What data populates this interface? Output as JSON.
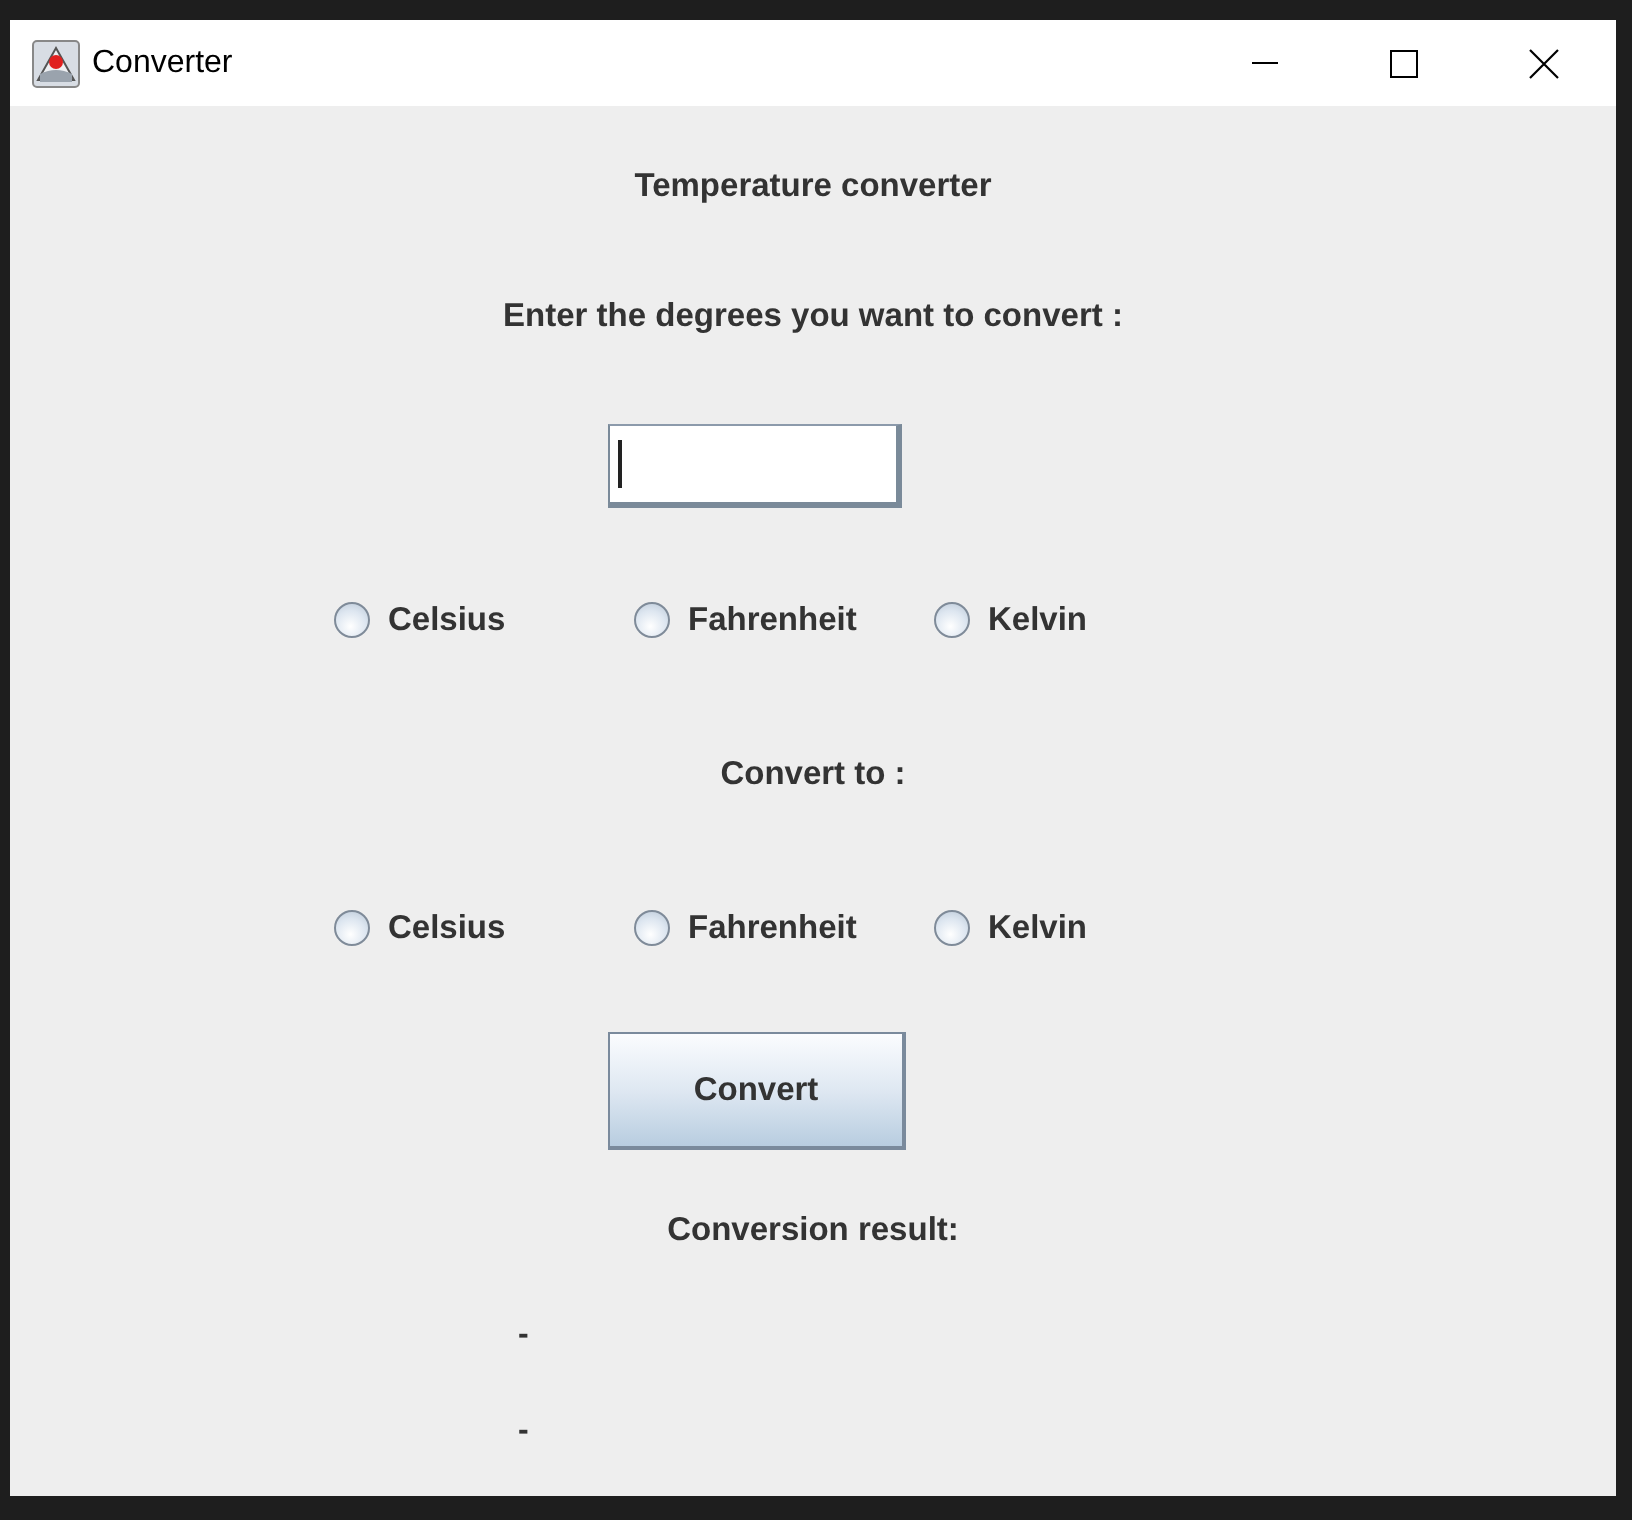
{
  "window": {
    "title": "Converter"
  },
  "heading": "Temperature converter",
  "prompt": "Enter the degrees you want to convert :",
  "degrees_field": {
    "focused": true
  },
  "from_units": [
    {
      "label": "Celsius",
      "selected": false
    },
    {
      "label": "Fahrenheit",
      "selected": false
    },
    {
      "label": "Kelvin",
      "selected": false
    }
  ],
  "convert_to_label": "Convert to :",
  "to_units": [
    {
      "label": "Celsius",
      "selected": false
    },
    {
      "label": "Fahrenheit",
      "selected": false
    },
    {
      "label": "Kelvin",
      "selected": false
    }
  ],
  "convert_button": "Convert",
  "result_label": "Conversion result:",
  "results": [
    "-",
    "-"
  ]
}
